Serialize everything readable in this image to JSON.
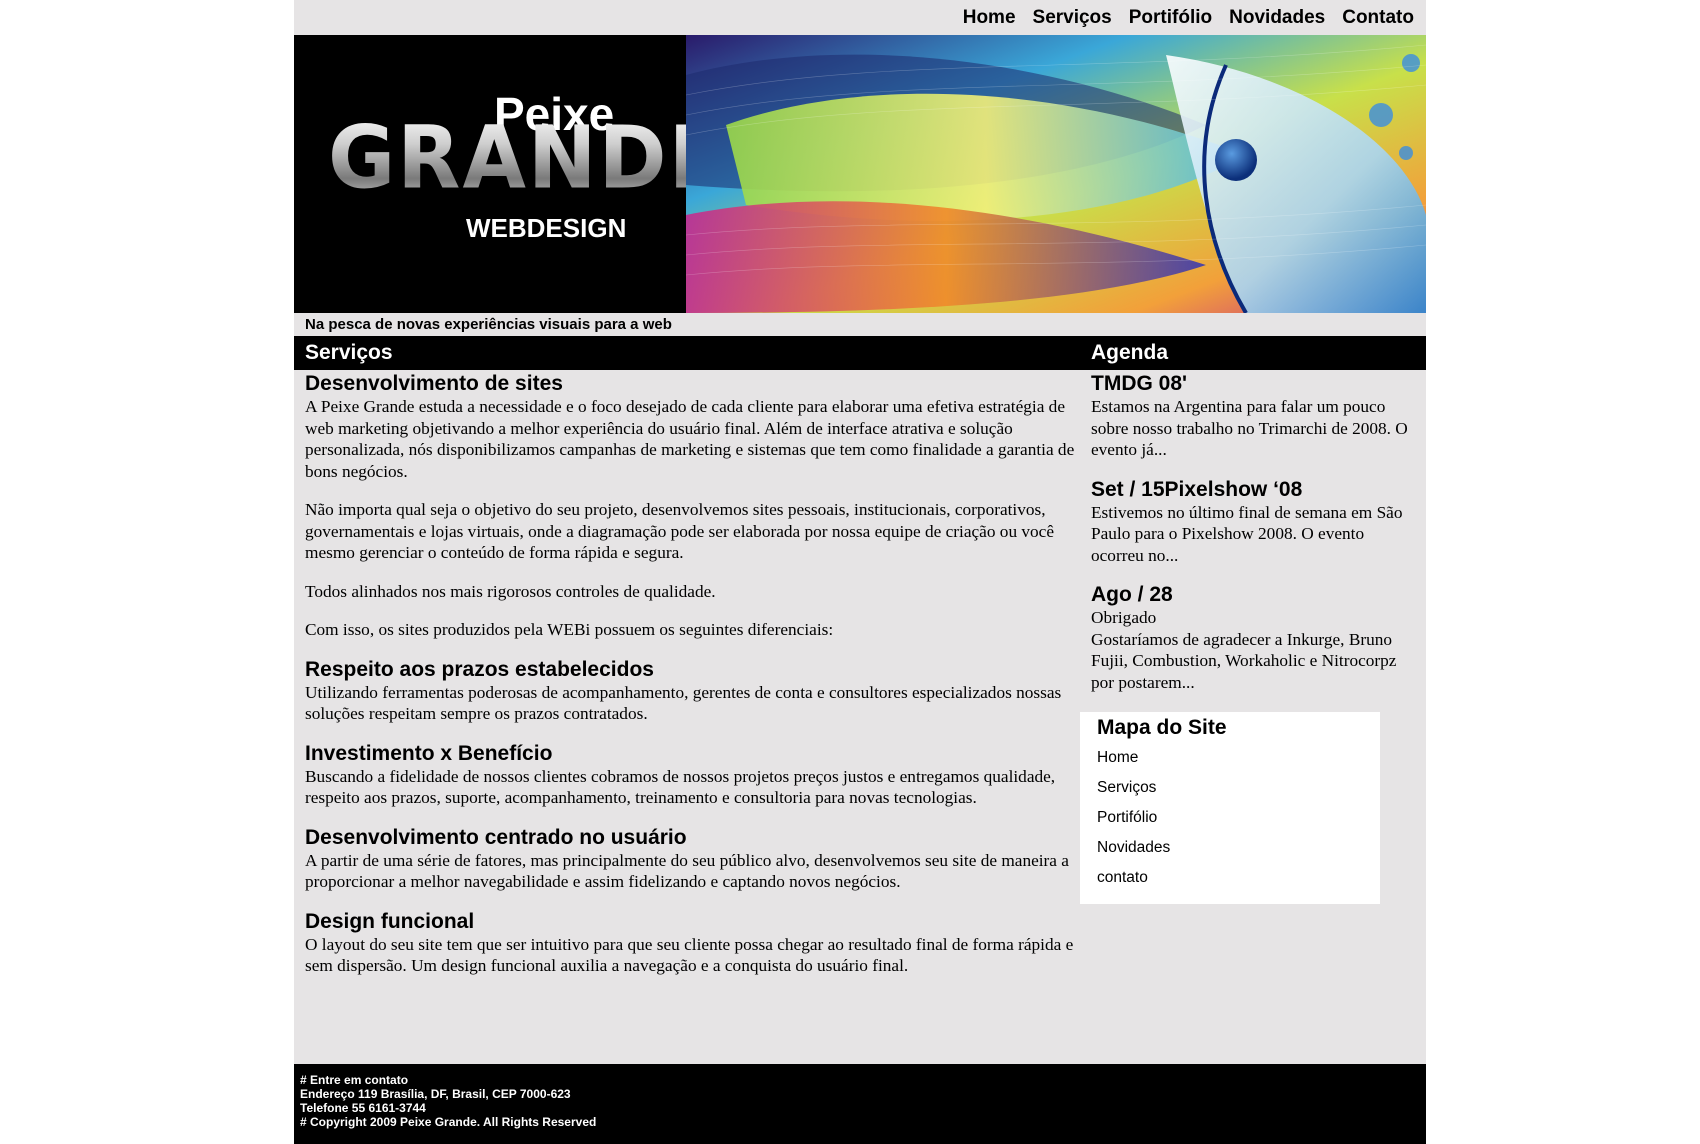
{
  "nav": {
    "items": [
      "Home",
      "Serviços",
      "Portifólio",
      "Novidades",
      "Contato"
    ]
  },
  "banner": {
    "logo_top": "Peixe",
    "logo_main": "GRANDE",
    "logo_bottom": "WEBDESIGN"
  },
  "tagline": "Na pesca de novas experiências visuais para a web",
  "sections": {
    "main_title": "Serviços",
    "side_title": "Agenda"
  },
  "main": {
    "intro_heading": "Desenvolvimento de sites",
    "paragraphs": [
      "A Peixe Grande estuda a necessidade e o foco desejado de cada cliente para elaborar uma efetiva estratégia de web marketing objetivando a melhor experiência do usuário final. Além de interface atrativa e solução personalizada, nós disponibilizamos campanhas de marketing e sistemas que tem como finalidade a garantia de bons negócios.",
      "Não importa qual seja o objetivo do seu projeto, desenvolvemos sites pessoais, institucionais, corporativos, governamentais e lojas virtuais, onde a diagramação pode ser elaborada por nossa equipe de criação ou você mesmo gerenciar o conteúdo de forma rápida e segura.",
      "Todos alinhados nos mais rigorosos controles de qualidade.",
      "Com isso, os sites produzidos pela WEBi possuem os seguintes diferenciais:"
    ],
    "features": [
      {
        "title": "Respeito aos prazos estabelecidos",
        "text": "Utilizando ferramentas poderosas de acompanhamento, gerentes de conta e consultores especializados nossas soluções respeitam sempre os prazos contratados."
      },
      {
        "title": "Investimento x Benefício",
        "text": "Buscando a fidelidade de nossos clientes cobramos de nossos projetos preços justos e entregamos qualidade, respeito aos prazos, suporte, acompanhamento, treinamento e consultoria para novas tecnologias."
      },
      {
        "title": "Desenvolvimento centrado no usuário",
        "text": "A partir de uma série de fatores, mas principalmente do seu público alvo, desenvolvemos seu site de maneira a proporcionar a melhor navegabilidade e assim fidelizando e captando novos negócios."
      },
      {
        "title": "Design funcional",
        "text": "O layout do seu site tem que ser intuitivo para que seu cliente possa chegar ao resultado final de forma rápida e sem dispersão. Um design funcional auxilia a navegação e a conquista do usuário final."
      }
    ]
  },
  "agenda": {
    "items": [
      {
        "title": "TMDG 08'",
        "subtitle": "",
        "text": "Estamos na Argentina para falar um pouco sobre nosso trabalho no Trimarchi de 2008. O evento já..."
      },
      {
        "title": "Set / 15Pixelshow ‘08",
        "subtitle": "",
        "text": "Estivemos no último final de semana em São Paulo para o Pixelshow 2008. O evento ocorreu no..."
      },
      {
        "title": "Ago / 28",
        "subtitle": "Obrigado",
        "text": "Gostaríamos de agradecer a Inkurge, Bruno Fujii, Combustion, Workaholic e Nitrocorpz por postarem..."
      }
    ]
  },
  "sitemap": {
    "title": "Mapa do Site",
    "links": [
      "Home",
      "Serviços",
      "Portifólio",
      "Novidades",
      "contato"
    ]
  },
  "footer": {
    "lines": [
      "# Entre em contato",
      "Endereço 119 Brasília, DF, Brasil, CEP 7000-623",
      "Telefone 55 6161-3744",
      "# Copyright 2009 Peixe Grande. All Rights Reserved"
    ]
  }
}
